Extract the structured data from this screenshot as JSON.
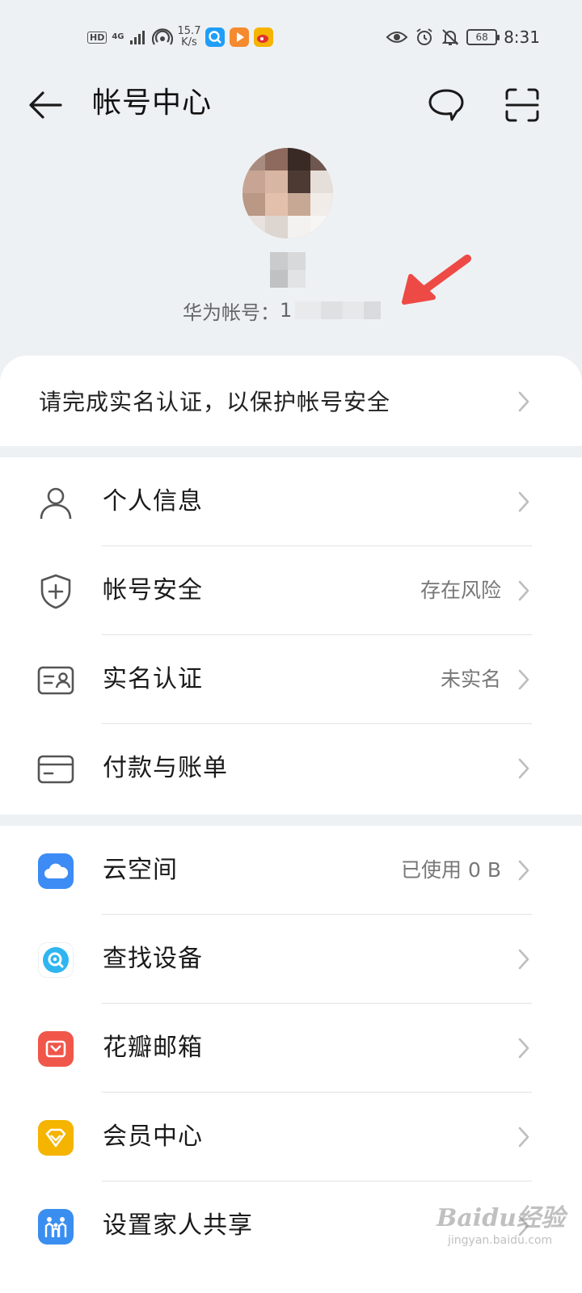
{
  "status_bar": {
    "left_badge": "HD",
    "network": "4G",
    "speed_value": "15.7",
    "speed_unit": "K/s",
    "battery": "68",
    "time": "8:31",
    "app_icons": [
      "search-app-icon",
      "video-app-icon",
      "weibo-icon"
    ],
    "right_icons": [
      "eye-icon",
      "alarm-icon",
      "bell-off-icon",
      "battery-icon"
    ]
  },
  "header": {
    "title": "帐号中心",
    "icons": [
      "back-arrow-icon",
      "message-icon",
      "scan-icon"
    ]
  },
  "profile": {
    "account_label": "华为帐号：",
    "account_visible_prefix": "1"
  },
  "notice": {
    "text": "请完成实名认证，以保护帐号安全"
  },
  "section_account": {
    "items": [
      {
        "label": "个人信息",
        "value": "",
        "icon": "person-icon"
      },
      {
        "label": "帐号安全",
        "value": "存在风险",
        "icon": "shield-plus-icon"
      },
      {
        "label": "实名认证",
        "value": "未实名",
        "icon": "id-card-icon"
      },
      {
        "label": "付款与账单",
        "value": "",
        "icon": "credit-card-icon"
      }
    ]
  },
  "section_services": {
    "items": [
      {
        "label": "云空间",
        "value": "已使用 0 B",
        "icon": "cloud-icon",
        "color": "#3d8bf5"
      },
      {
        "label": "查找设备",
        "value": "",
        "icon": "find-device-icon",
        "color": "#2fb5f0"
      },
      {
        "label": "花瓣邮箱",
        "value": "",
        "icon": "mail-icon",
        "color": "#f0564a"
      },
      {
        "label": "会员中心",
        "value": "",
        "icon": "diamond-icon",
        "color": "#f5b400"
      },
      {
        "label": "设置家人共享",
        "value": "",
        "icon": "family-icon",
        "color": "#3a8ef0"
      }
    ]
  },
  "watermark": {
    "brand": "Baidu经验",
    "url": "jingyan.baidu.com"
  },
  "colors": {
    "background": "#eef1f4",
    "card": "#ffffff",
    "arrow_annotation": "#ee4a45"
  }
}
